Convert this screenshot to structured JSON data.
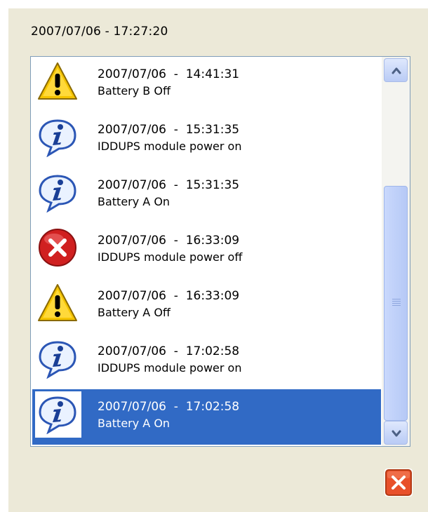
{
  "window": {
    "current_time": "2007/07/06  -  17:27:20"
  },
  "events": [
    {
      "icon": "warning-icon",
      "datetime": "2007/07/06  -  14:41:31",
      "message": "Battery B Off"
    },
    {
      "icon": "info-icon",
      "datetime": "2007/07/06  -  15:31:35",
      "message": "IDDUPS module power on"
    },
    {
      "icon": "info-icon",
      "datetime": "2007/07/06  -  15:31:35",
      "message": "Battery A On"
    },
    {
      "icon": "error-icon",
      "datetime": "2007/07/06  -  16:33:09",
      "message": "IDDUPS module power off"
    },
    {
      "icon": "warning-icon",
      "datetime": "2007/07/06  -  16:33:09",
      "message": "Battery A Off"
    },
    {
      "icon": "info-icon",
      "datetime": "2007/07/06  -  17:02:58",
      "message": "IDDUPS module power on"
    },
    {
      "icon": "info-icon",
      "datetime": "2007/07/06  -  17:02:58",
      "message": "Battery A On",
      "selected": true
    }
  ],
  "colors": {
    "selection": "#316ac5",
    "panel": "#ece9d8",
    "warning": "#f5c400",
    "error": "#d02020",
    "info": "#2b56b5",
    "close": "#e8502a"
  }
}
